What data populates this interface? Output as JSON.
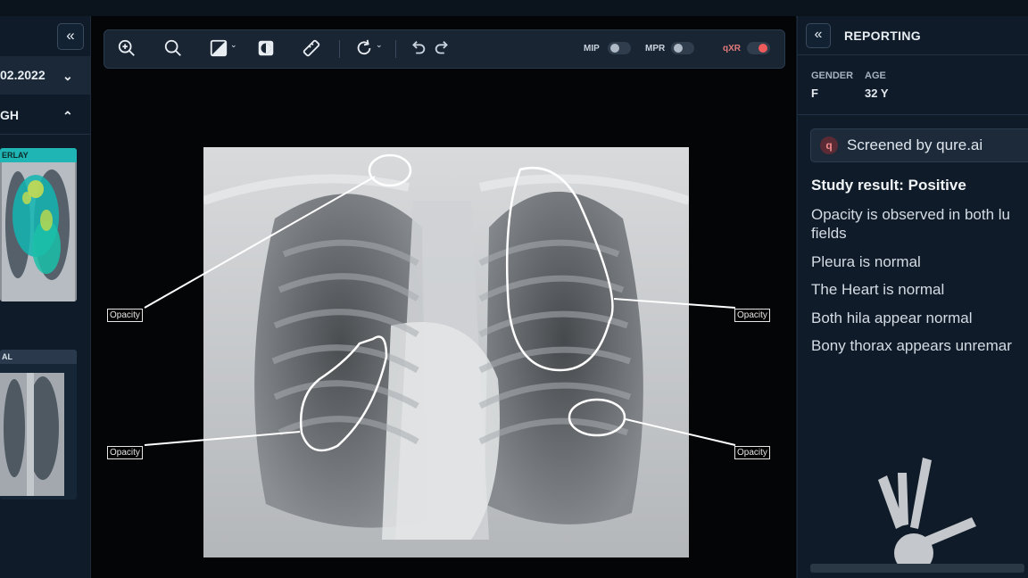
{
  "left_panel": {
    "collapse_icon": "double-chevron-left-icon",
    "date": "02.2022",
    "hospital": "GH",
    "thumbnails": [
      {
        "label": "ERLAY",
        "label_color": "#1fb5b5"
      },
      {
        "label": "AL",
        "label_color": "#2a3a4c"
      }
    ]
  },
  "toolbar": {
    "tools": [
      "zoom-in-icon",
      "search-icon",
      "brightness-contrast-icon",
      "invert-icon",
      "ruler-icon",
      "rotate-icon",
      "undo-icon",
      "redo-icon"
    ],
    "toggles": [
      {
        "label": "MIP",
        "on": false
      },
      {
        "label": "MPR",
        "on": false
      },
      {
        "label": "qXR",
        "on": true
      }
    ]
  },
  "annotations": [
    "Opacity",
    "Opacity",
    "Opacity",
    "Opacity"
  ],
  "right_panel": {
    "title": "REPORTING",
    "gender_label": "GENDER",
    "gender": "F",
    "age_label": "AGE",
    "age": "32 Y",
    "screened_by": "Screened by qure.ai",
    "study_result": "Study result: Positive",
    "findings": [
      "Opacity is observed in both lu fields",
      "Pleura is normal",
      "The Heart is normal",
      "Both hila appear normal",
      "Bony thorax appears unremar"
    ]
  },
  "colors": {
    "accent": "#1fb5b5",
    "toggle_on": "#e05555",
    "panel": "#0f1b28"
  }
}
